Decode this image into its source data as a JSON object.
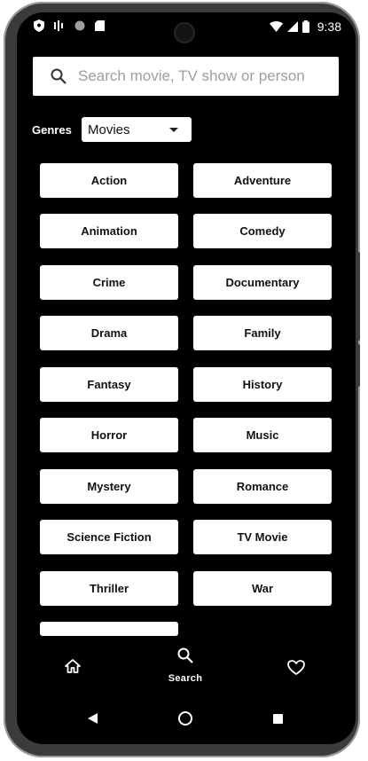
{
  "status_bar": {
    "time": "9:38",
    "left_icons": [
      "shield-icon",
      "signal-bars-icon",
      "circle-icon",
      "sd-card-icon"
    ],
    "right_icons": [
      "wifi-icon",
      "cellular-icon",
      "battery-icon"
    ]
  },
  "search": {
    "placeholder": "Search movie, TV show or person",
    "value": ""
  },
  "genres": {
    "label": "Genres",
    "selected": "Movies",
    "items": [
      "Action",
      "Adventure",
      "Animation",
      "Comedy",
      "Crime",
      "Documentary",
      "Drama",
      "Family",
      "Fantasy",
      "History",
      "Horror",
      "Music",
      "Mystery",
      "Romance",
      "Science Fiction",
      "TV Movie",
      "Thriller",
      "War"
    ]
  },
  "bottom_nav": {
    "items": [
      {
        "icon": "home-icon",
        "label": ""
      },
      {
        "icon": "search-icon",
        "label": "Search"
      },
      {
        "icon": "heart-icon",
        "label": ""
      }
    ]
  },
  "colors": {
    "background": "#000000",
    "tile": "#ffffff",
    "text_dark": "#111111"
  }
}
